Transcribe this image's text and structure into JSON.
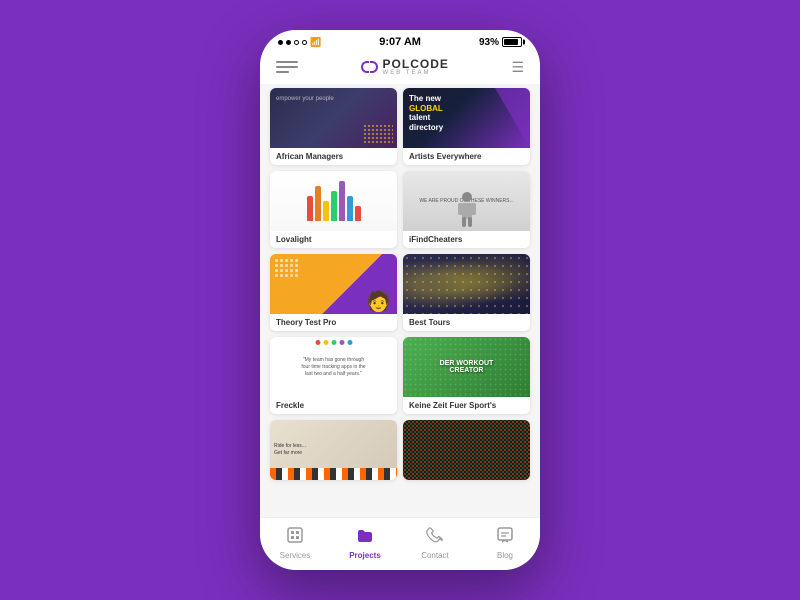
{
  "phone": {
    "statusBar": {
      "time": "9:07 AM",
      "battery": "93%"
    },
    "header": {
      "logoMain": "POLCODE",
      "logoSub": "WEB TEAM",
      "filterLabel": "filter"
    },
    "grid": {
      "cards": [
        {
          "id": "african-managers",
          "label": "African Managers",
          "imageType": "african-managers"
        },
        {
          "id": "artists-everywhere",
          "label": "Artists Everywhere",
          "imageType": "artists-everywhere"
        },
        {
          "id": "lovalight",
          "label": "Lovalight",
          "imageType": "lovalight"
        },
        {
          "id": "ifindcheaters",
          "label": "iFindCheaters",
          "imageType": "ifindcheaters"
        },
        {
          "id": "theory-test-pro",
          "label": "Theory Test Pro",
          "imageType": "theory-test"
        },
        {
          "id": "best-tours",
          "label": "Best Tours",
          "imageType": "best-tours"
        },
        {
          "id": "freckle",
          "label": "Freckle",
          "imageType": "freckle"
        },
        {
          "id": "keine-zeit",
          "label": "Keine Zeit Fuer Sport's",
          "imageType": "keine-zeit"
        },
        {
          "id": "partial1",
          "label": "",
          "imageType": "partial1"
        },
        {
          "id": "partial2",
          "label": "",
          "imageType": "partial2"
        }
      ]
    },
    "bottomNav": {
      "items": [
        {
          "id": "services",
          "label": "Services",
          "icon": "☐",
          "active": false
        },
        {
          "id": "projects",
          "label": "Projects",
          "icon": "📁",
          "active": true
        },
        {
          "id": "contact",
          "label": "Contact",
          "icon": "📞",
          "active": false
        },
        {
          "id": "blog",
          "label": "Blog",
          "icon": "💬",
          "active": false
        }
      ]
    }
  }
}
